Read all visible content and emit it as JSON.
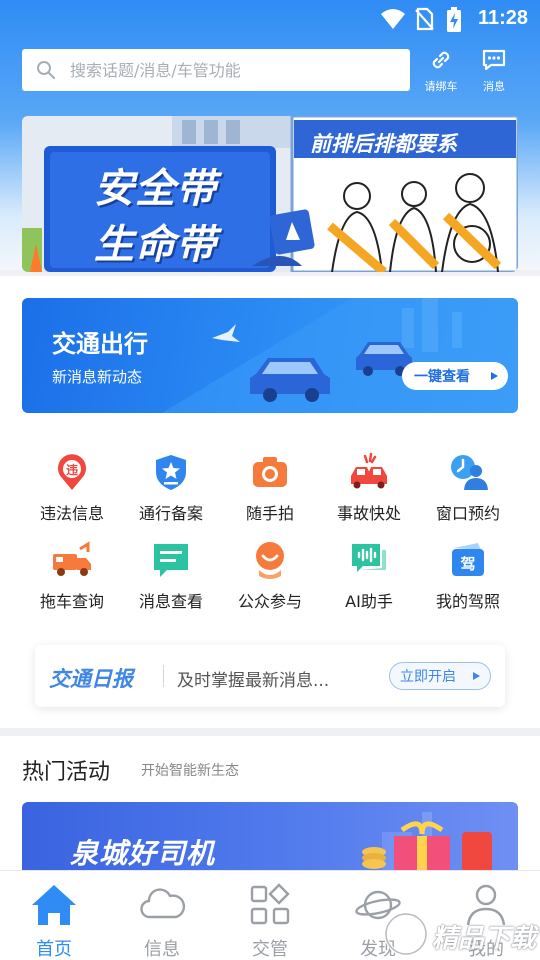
{
  "status_bar": {
    "time": "11:28"
  },
  "search": {
    "placeholder": "搜索话题/消息/车管功能"
  },
  "header_actions": [
    {
      "label": "请绑车",
      "icon": "link-icon"
    },
    {
      "label": "消息",
      "icon": "message-icon"
    }
  ],
  "banner": {
    "left_line1": "安全带",
    "left_line2": "生命带",
    "right_title": "前排后排都要系"
  },
  "traffic_card": {
    "title": "交通出行",
    "subtitle": "新消息新动态",
    "button": "一键查看"
  },
  "services": [
    {
      "label": "违法信息",
      "icon": "violation-icon"
    },
    {
      "label": "通行备案",
      "icon": "shield-star-icon"
    },
    {
      "label": "随手拍",
      "icon": "camera-icon"
    },
    {
      "label": "事故快处",
      "icon": "car-accident-icon"
    },
    {
      "label": "窗口预约",
      "icon": "appointment-icon"
    },
    {
      "label": "拖车查询",
      "icon": "tow-truck-icon"
    },
    {
      "label": "消息查看",
      "icon": "chat-icon"
    },
    {
      "label": "公众参与",
      "icon": "participate-icon"
    },
    {
      "label": "AI助手",
      "icon": "voice-assistant-icon"
    },
    {
      "label": "我的驾照",
      "icon": "license-icon"
    }
  ],
  "daily_report": {
    "title": "交通日报",
    "text": "及时掌握最新消息...",
    "button": "立即开启"
  },
  "hot": {
    "title": "热门活动",
    "subtitle": "开始智能新生态",
    "banner_title": "泉城好司机"
  },
  "tabs": [
    {
      "label": "首页",
      "icon": "home-icon",
      "active": true
    },
    {
      "label": "信息",
      "icon": "cloud-icon",
      "active": false
    },
    {
      "label": "交管",
      "icon": "apps-icon",
      "active": false
    },
    {
      "label": "发现",
      "icon": "planet-icon",
      "active": false
    },
    {
      "label": "我的",
      "icon": "user-icon",
      "active": false
    }
  ],
  "watermark": "精品下载",
  "colors": {
    "primary": "#2f8cf4",
    "tab_inactive": "#9aa0a6"
  }
}
